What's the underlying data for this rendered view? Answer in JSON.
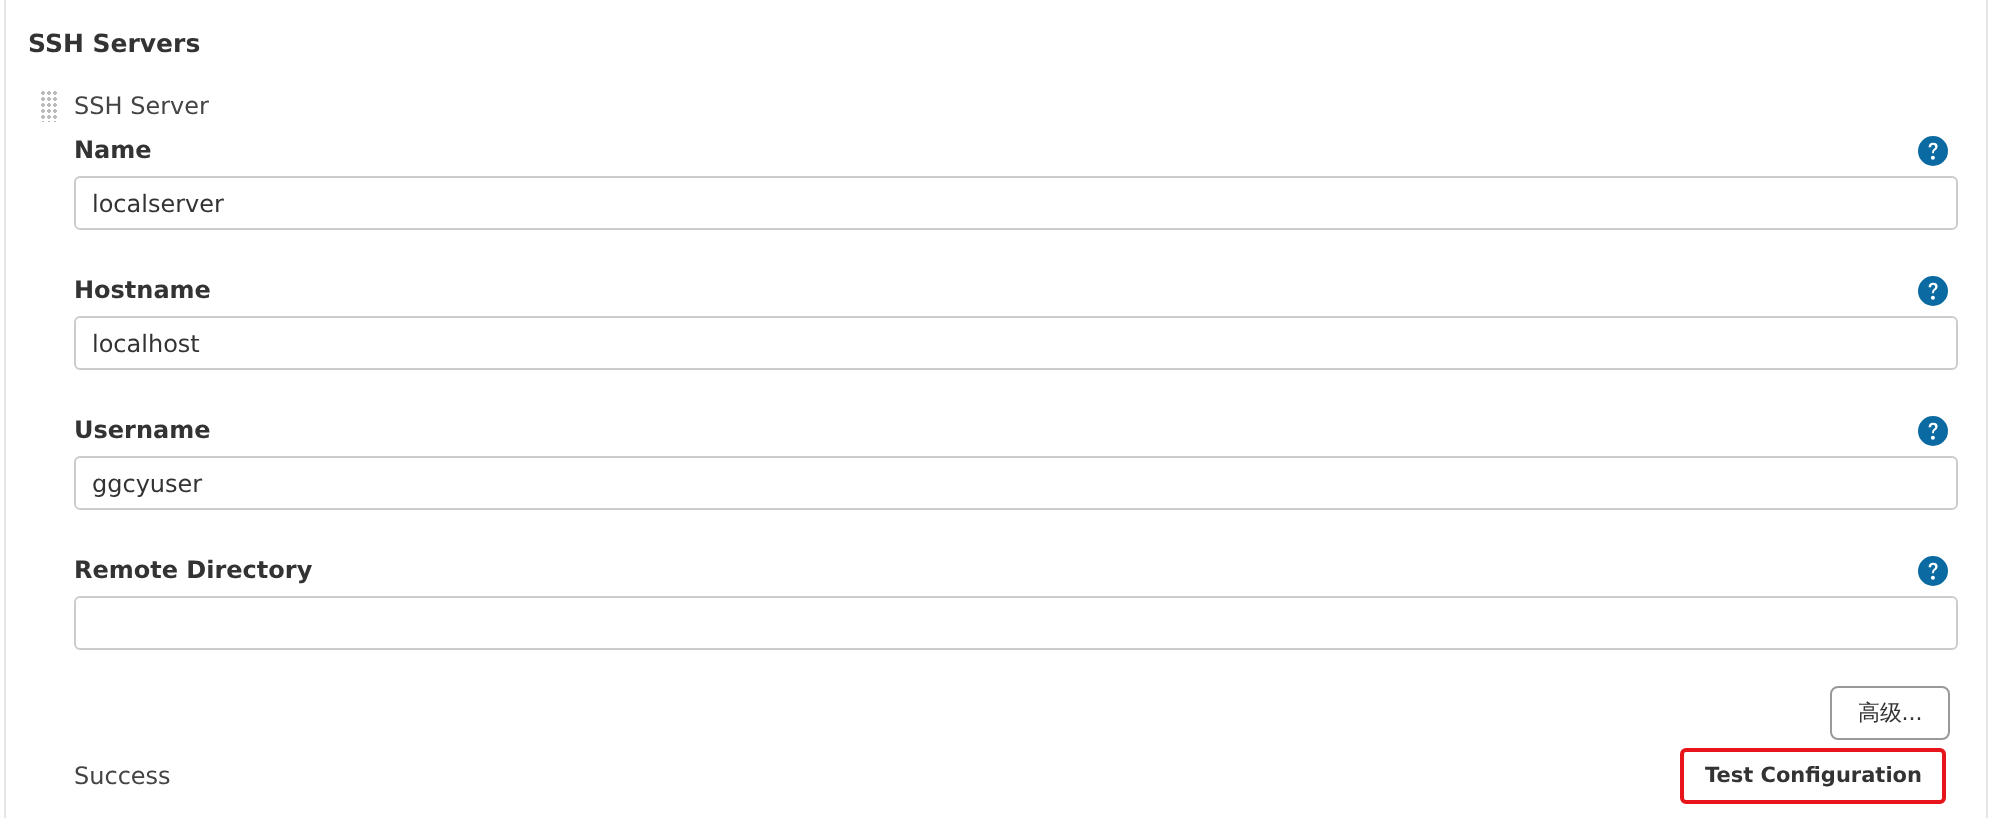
{
  "section_title": "SSH Servers",
  "server": {
    "title": "SSH Server",
    "fields": [
      {
        "label": "Name",
        "value": "localserver"
      },
      {
        "label": "Hostname",
        "value": "localhost"
      },
      {
        "label": "Username",
        "value": "ggcyuser"
      },
      {
        "label": "Remote Directory"
      }
    ],
    "advanced_button": "高级...",
    "status": "Success",
    "test_button": {
      "label": "Test Configuration",
      "highlighted": true
    }
  }
}
